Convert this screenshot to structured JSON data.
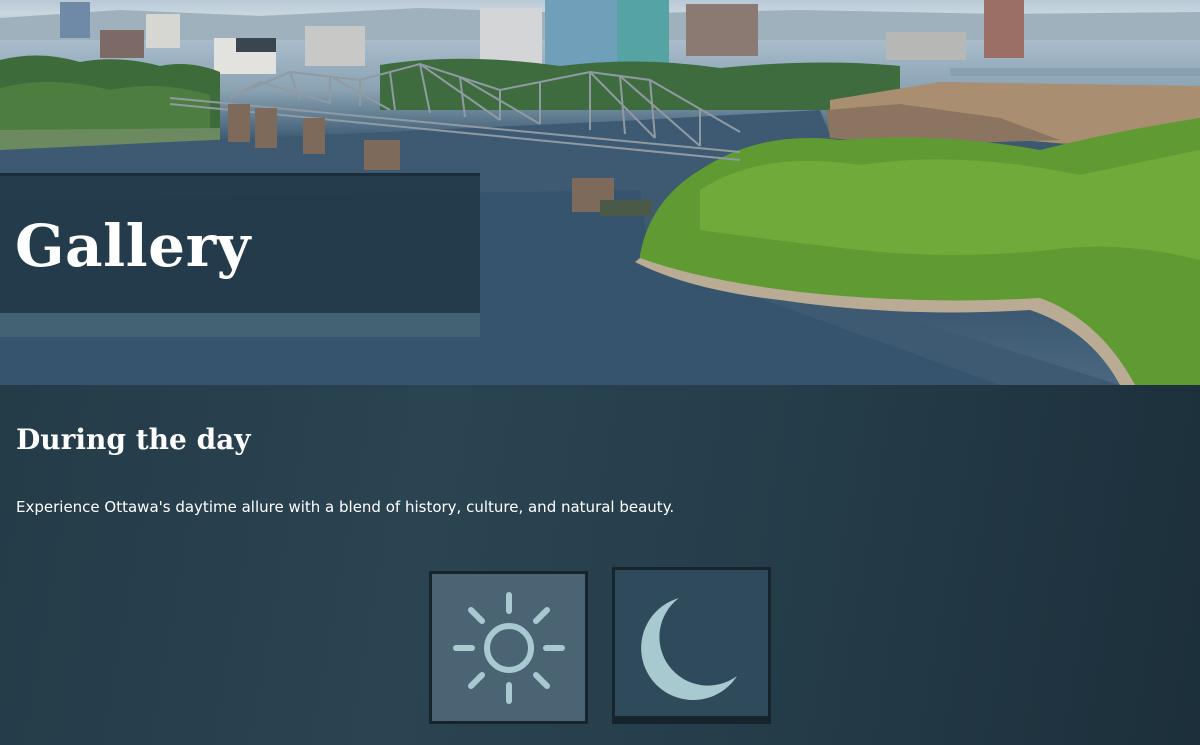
{
  "hero": {
    "title": "Gallery",
    "image_alt": "Ottawa river with Alexandra Bridge and city skyline"
  },
  "section": {
    "title": "During the day",
    "description": "Experience Ottawa's daytime allure with a blend of history, culture, and natural beauty."
  },
  "toggles": [
    {
      "icon": "sun-icon",
      "state": "selected"
    },
    {
      "icon": "moon-icon",
      "state": "unselected"
    }
  ],
  "colors": {
    "background": "#223845",
    "banner": "#223a48",
    "banner_strip": "#466476",
    "toggle_day_bg": "#4a6474",
    "toggle_night_bg": "#2f4b5b",
    "icon_color": "#a9c9d1",
    "text": "#ffffff"
  }
}
